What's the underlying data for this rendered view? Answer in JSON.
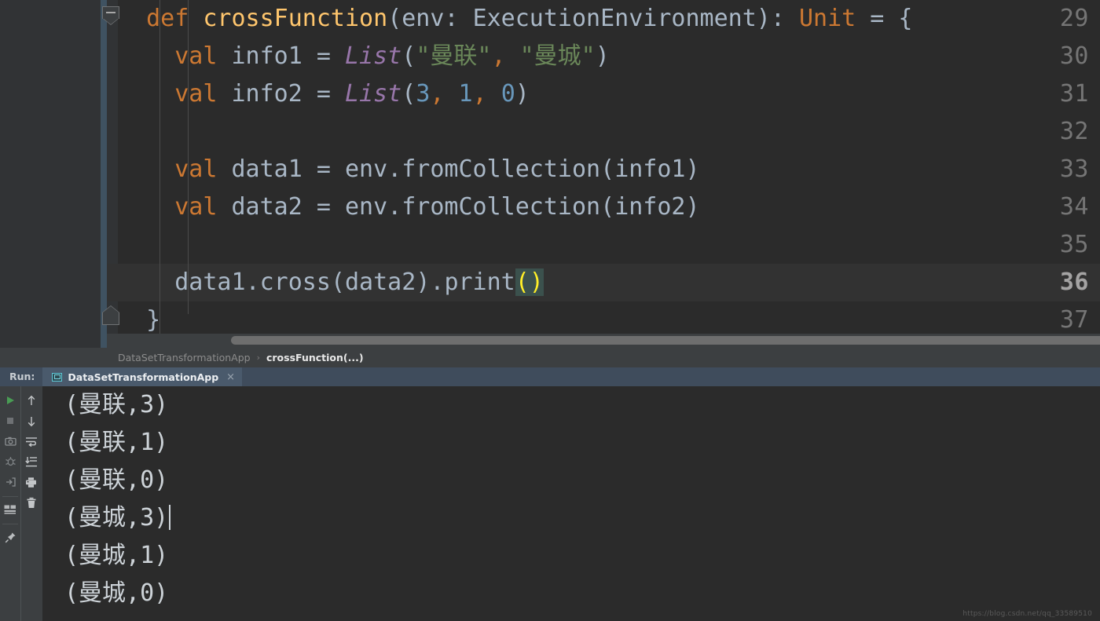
{
  "editor": {
    "lines": [
      {
        "num": "29",
        "current": false,
        "fold": "collapse-down",
        "tokens": [
          {
            "t": "  ",
            "c": "t"
          },
          {
            "t": "def ",
            "c": "k"
          },
          {
            "t": "crossFunction",
            "c": "fn"
          },
          {
            "t": "(",
            "c": "p"
          },
          {
            "t": "env",
            "c": "t"
          },
          {
            "t": ": ",
            "c": "p"
          },
          {
            "t": "ExecutionEnvironment",
            "c": "t"
          },
          {
            "t": ")",
            "c": "p"
          },
          {
            "t": ": ",
            "c": "p"
          },
          {
            "t": "Unit",
            "c": "ty"
          },
          {
            "t": " = {",
            "c": "t"
          }
        ]
      },
      {
        "num": "30",
        "current": false,
        "tokens": [
          {
            "t": "    ",
            "c": "t"
          },
          {
            "t": "val ",
            "c": "k"
          },
          {
            "t": "info1",
            "c": "t"
          },
          {
            "t": " = ",
            "c": "t"
          },
          {
            "t": "List",
            "c": "cl"
          },
          {
            "t": "(",
            "c": "p"
          },
          {
            "t": "\"曼联\"",
            "c": "s"
          },
          {
            "t": ",",
            "c": "k"
          },
          {
            "t": " ",
            "c": "t"
          },
          {
            "t": "\"曼城\"",
            "c": "s"
          },
          {
            "t": ")",
            "c": "p"
          }
        ]
      },
      {
        "num": "31",
        "current": false,
        "tokens": [
          {
            "t": "    ",
            "c": "t"
          },
          {
            "t": "val ",
            "c": "k"
          },
          {
            "t": "info2",
            "c": "t"
          },
          {
            "t": " = ",
            "c": "t"
          },
          {
            "t": "List",
            "c": "cl"
          },
          {
            "t": "(",
            "c": "p"
          },
          {
            "t": "3",
            "c": "n"
          },
          {
            "t": ",",
            "c": "k"
          },
          {
            "t": " ",
            "c": "t"
          },
          {
            "t": "1",
            "c": "n"
          },
          {
            "t": ",",
            "c": "k"
          },
          {
            "t": " ",
            "c": "t"
          },
          {
            "t": "0",
            "c": "n"
          },
          {
            "t": ")",
            "c": "p"
          }
        ]
      },
      {
        "num": "32",
        "current": false,
        "tokens": []
      },
      {
        "num": "33",
        "current": false,
        "tokens": [
          {
            "t": "    ",
            "c": "t"
          },
          {
            "t": "val ",
            "c": "k"
          },
          {
            "t": "data1",
            "c": "t"
          },
          {
            "t": " = ",
            "c": "t"
          },
          {
            "t": "env",
            "c": "t"
          },
          {
            "t": ".",
            "c": "p"
          },
          {
            "t": "fromCollection",
            "c": "t"
          },
          {
            "t": "(",
            "c": "p"
          },
          {
            "t": "info1",
            "c": "t"
          },
          {
            "t": ")",
            "c": "p"
          }
        ]
      },
      {
        "num": "34",
        "current": false,
        "tokens": [
          {
            "t": "    ",
            "c": "t"
          },
          {
            "t": "val ",
            "c": "k"
          },
          {
            "t": "data2",
            "c": "t"
          },
          {
            "t": " = ",
            "c": "t"
          },
          {
            "t": "env",
            "c": "t"
          },
          {
            "t": ".",
            "c": "p"
          },
          {
            "t": "fromCollection",
            "c": "t"
          },
          {
            "t": "(",
            "c": "p"
          },
          {
            "t": "info2",
            "c": "t"
          },
          {
            "t": ")",
            "c": "p"
          }
        ]
      },
      {
        "num": "35",
        "current": false,
        "tokens": []
      },
      {
        "num": "36",
        "current": true,
        "tokens": [
          {
            "t": "    ",
            "c": "t"
          },
          {
            "t": "data1",
            "c": "t"
          },
          {
            "t": ".",
            "c": "p"
          },
          {
            "t": "cross",
            "c": "t"
          },
          {
            "t": "(",
            "c": "p"
          },
          {
            "t": "data2",
            "c": "t"
          },
          {
            "t": ")",
            "c": "p"
          },
          {
            "t": ".",
            "c": "p"
          },
          {
            "t": "print",
            "c": "t"
          },
          {
            "t": "()",
            "c": "brace-hl"
          }
        ]
      },
      {
        "num": "37",
        "current": false,
        "fold": "collapse-up",
        "tokens": [
          {
            "t": "  }",
            "c": "t"
          }
        ]
      }
    ],
    "colors": {
      "background": "#2b2b2b",
      "gutter": "#313335",
      "current_line": "#323232",
      "keyword": "#cc7832",
      "function": "#ffc66d",
      "string": "#6a8759",
      "number": "#6897bb",
      "class": "#9876aa",
      "text": "#a9b7c6",
      "brace_match_bg": "#3b514d",
      "brace_match_fg": "#ffef28"
    }
  },
  "breadcrumb": {
    "items": [
      "DataSetTransformationApp",
      "crossFunction(...)"
    ],
    "separator": "›"
  },
  "run_window": {
    "label": "Run:",
    "tab": {
      "title": "DataSetTransformationApp",
      "close": "×",
      "icon": "application-icon"
    },
    "toolbar_left": [
      {
        "name": "rerun-button",
        "title": "Rerun"
      },
      {
        "name": "stop-button",
        "title": "Stop"
      },
      {
        "name": "camera-button",
        "title": "Dump Threads"
      },
      {
        "name": "debug-button",
        "title": "Debug"
      },
      {
        "name": "export-button",
        "title": "Export"
      },
      {
        "name": "console-button",
        "title": "Console"
      },
      {
        "name": "pin-button",
        "title": "Pin Tab"
      }
    ],
    "toolbar_right": [
      {
        "name": "up-arrow-button",
        "title": "Previous Occurrence"
      },
      {
        "name": "down-arrow-button",
        "title": "Next Occurrence"
      },
      {
        "name": "soft-wrap-button",
        "title": "Soft-Wrap"
      },
      {
        "name": "scroll-to-end-button",
        "title": "Scroll to End"
      },
      {
        "name": "print-button",
        "title": "Print"
      },
      {
        "name": "clear-all-button",
        "title": "Clear All"
      }
    ],
    "console_output": [
      {
        "text": "(曼联,3)",
        "caret": false
      },
      {
        "text": "(曼联,1)",
        "caret": false
      },
      {
        "text": "(曼联,0)",
        "caret": false
      },
      {
        "text": "(曼城,3)",
        "caret": true
      },
      {
        "text": "(曼城,1)",
        "caret": false
      },
      {
        "text": "(曼城,0)",
        "caret": false
      }
    ]
  },
  "watermark": {
    "text": "https://blog.csdn.net/qq_33589510"
  }
}
